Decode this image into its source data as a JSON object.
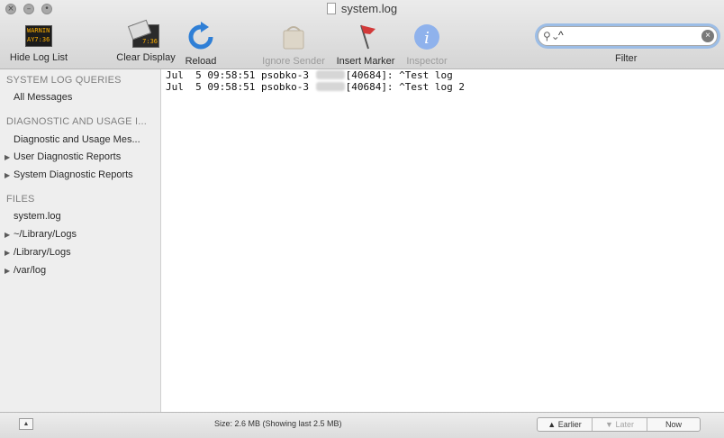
{
  "window": {
    "title": "system.log"
  },
  "toolbar": {
    "hide_log_list": {
      "label": "Hide Log List",
      "icon": "warning-display-icon",
      "icon_text": "WARNIN\nAY7:36"
    },
    "clear_display": {
      "label": "Clear Display",
      "icon": "clear-display-icon",
      "icon_text": "7:36"
    },
    "reload": {
      "label": "Reload",
      "icon": "reload-icon"
    },
    "ignore_sender": {
      "label": "Ignore Sender",
      "icon": "ignore-sender-icon",
      "enabled": false
    },
    "insert_marker": {
      "label": "Insert Marker",
      "icon": "flag-icon"
    },
    "inspector": {
      "label": "Inspector",
      "icon": "info-icon",
      "enabled": false
    },
    "filter": {
      "label": "Filter",
      "value": "^"
    }
  },
  "sidebar": {
    "system_log_queries": {
      "header": "SYSTEM LOG QUERIES",
      "items": [
        "All Messages"
      ]
    },
    "diagnostic": {
      "header": "DIAGNOSTIC AND USAGE I...",
      "items": [
        "Diagnostic and Usage Mes...",
        "User Diagnostic Reports",
        "System Diagnostic Reports"
      ]
    },
    "files": {
      "header": "FILES",
      "items": [
        "system.log",
        "~/Library/Logs",
        "/Library/Logs",
        "/var/log"
      ]
    }
  },
  "log": {
    "lines": [
      {
        "prefix": "Jul  5 09:58:51 psobko-3 ",
        "suffix": "[40684]: ^Test log"
      },
      {
        "prefix": "Jul  5 09:58:51 psobko-3 ",
        "suffix": "[40684]: ^Test log 2"
      }
    ]
  },
  "statusbar": {
    "size_text": "Size: 2.6 MB (Showing last 2.5 MB)",
    "earlier": "Earlier",
    "later": "Later",
    "now": "Now"
  },
  "colors": {
    "accent_focus": "#9cbde6",
    "info_blue": "#6f9be8",
    "reload_blue": "#2f7fd6",
    "flag_red": "#d23a3a"
  }
}
